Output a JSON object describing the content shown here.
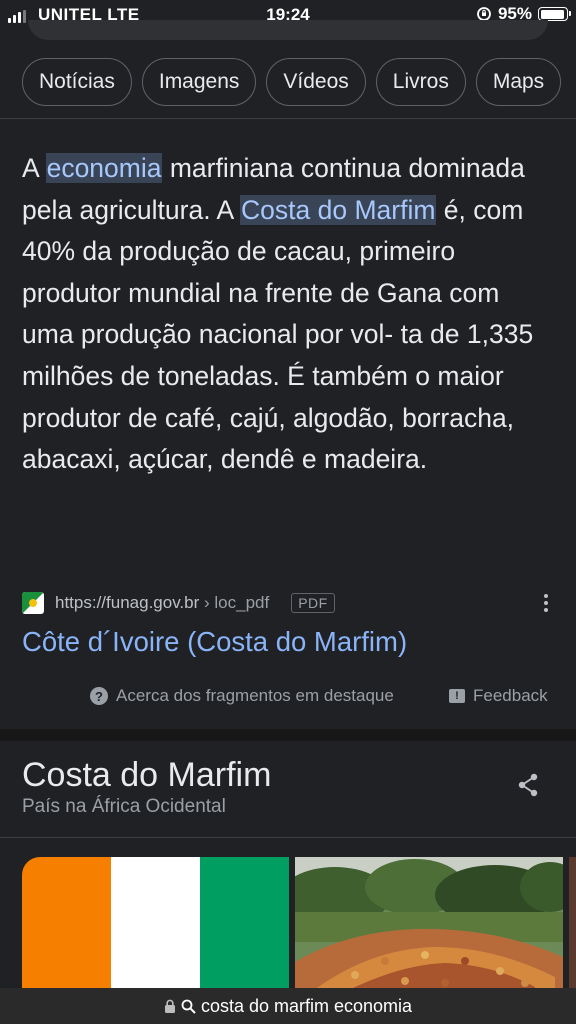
{
  "status_bar": {
    "carrier": "UNITEL  LTE",
    "time": "19:24",
    "battery": "95%",
    "battery_level": 0.95
  },
  "chips": [
    "Notícias",
    "Imagens",
    "Vídeos",
    "Livros",
    "Maps"
  ],
  "snippet": {
    "before_1": "A ",
    "highlight_1": "economia",
    "between_1": " marfiniana continua dominada pela agricultura. A ",
    "highlight_2": "Costa do Marfim",
    "after": " é, com 40% da produção de cacau, primeiro produtor mundial na frente de Gana com uma produção nacional por vol- ta de 1,335 milhões de toneladas. É também o maior produtor de café, cajú, algodão, borracha, abacaxi, açúcar, dendê e madeira."
  },
  "source": {
    "url": "https://funag.gov.br",
    "path": " › loc_pdf",
    "badge": "PDF",
    "title": "Côte d´Ivoire (Costa do Marfim)"
  },
  "about_text": "Acerca dos fragmentos em destaque",
  "feedback_text": "Feedback",
  "knowledge_panel": {
    "title": "Costa do Marfim",
    "subtitle": "País na África Ocidental"
  },
  "flag_colors": [
    "#f77f00",
    "#ffffff",
    "#009e60"
  ],
  "address_bar": {
    "query": "costa do marfim economia"
  },
  "colors": {
    "background": "#202124",
    "link": "#8ab4f8",
    "highlight_bg": "#394457",
    "highlight_text": "#a8c7fa"
  }
}
